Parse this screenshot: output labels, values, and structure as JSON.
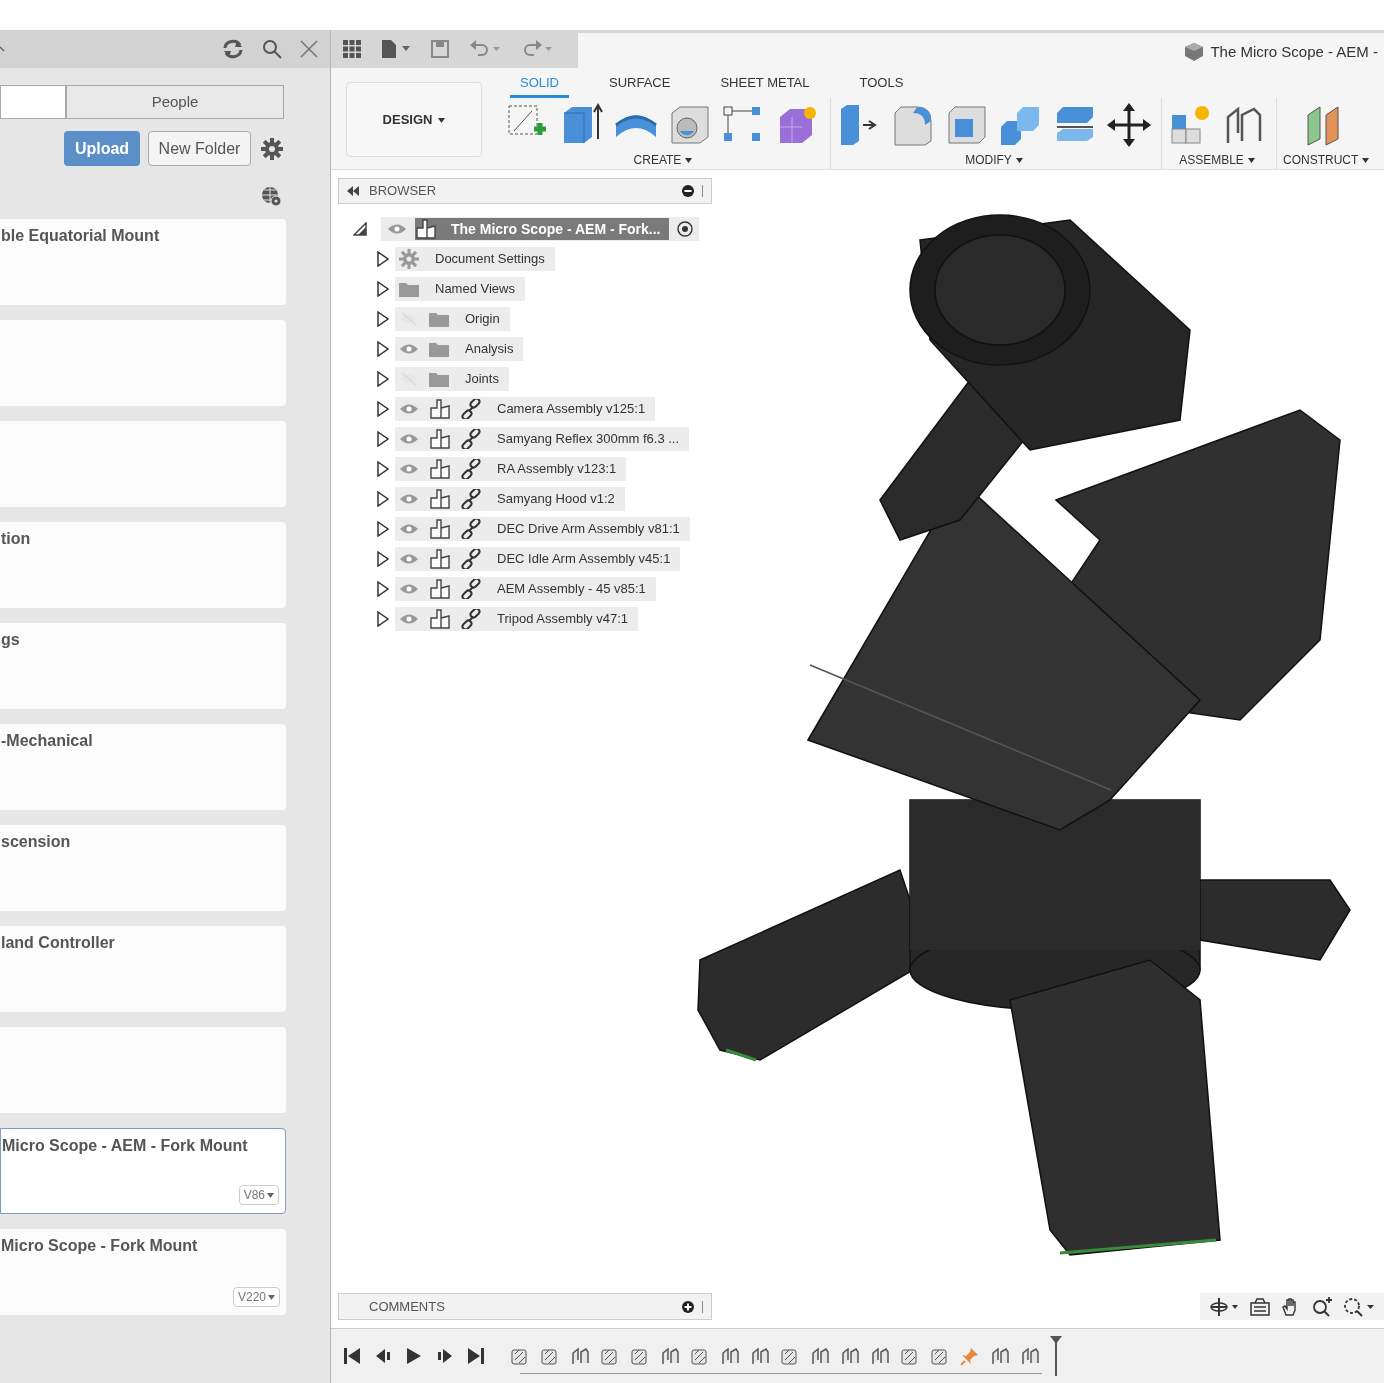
{
  "data_panel": {
    "tabs": [
      {
        "selected": true
      },
      {
        "label": "People",
        "selected": false
      }
    ],
    "buttons": {
      "upload": "Upload",
      "new_folder": "New Folder"
    },
    "cards": [
      {
        "title": "ble Equatorial Mount",
        "selected": false
      },
      {
        "selected": false
      },
      {
        "selected": false
      },
      {
        "title": "tion",
        "selected": false
      },
      {
        "title": "gs",
        "selected": false
      },
      {
        "title": "-Mechanical",
        "selected": false
      },
      {
        "title": "scension",
        "selected": false
      },
      {
        "title": "land Controller",
        "selected": false
      },
      {
        "selected": false
      },
      {
        "title": "Micro Scope - AEM - Fork Mount",
        "version": "V86",
        "selected": true
      },
      {
        "title": "Micro Scope - Fork Mount",
        "version": "V220",
        "selected": false
      }
    ]
  },
  "document_tab": {
    "title": "The Micro Scope - AEM -"
  },
  "toolbar": {
    "workspace": "DESIGN",
    "tabs": [
      {
        "label": "SOLID",
        "selected": true
      },
      {
        "label": "SURFACE",
        "selected": false
      },
      {
        "label": "SHEET METAL",
        "selected": false
      },
      {
        "label": "TOOLS",
        "selected": false
      }
    ],
    "groups": [
      {
        "kind": "create",
        "label": "CREATE"
      },
      {
        "kind": "modify",
        "label": "MODIFY"
      },
      {
        "kind": "assemble",
        "label": "ASSEMBLE"
      },
      {
        "kind": "construct",
        "label": "CONSTRUCT"
      }
    ]
  },
  "browser": {
    "title": "BROWSER",
    "root": {
      "label": "The Micro Scope - AEM - Fork...",
      "expanded": true,
      "selected": true,
      "visible": true,
      "children": [
        {
          "label": "Document Settings",
          "kind": "settings",
          "expanded": false
        },
        {
          "label": "Named Views",
          "kind": "folder",
          "expanded": false
        },
        {
          "label": "Origin",
          "kind": "folder",
          "expanded": false,
          "visible": false
        },
        {
          "label": "Analysis",
          "kind": "folder",
          "expanded": false,
          "visible": true
        },
        {
          "label": "Joints",
          "kind": "folder",
          "expanded": false,
          "visible": false
        },
        {
          "label": "Camera Assembly v125:1",
          "kind": "component",
          "expanded": false,
          "visible": true
        },
        {
          "label": "Samyang Reflex 300mm f6.3 ...",
          "kind": "component",
          "expanded": false,
          "visible": true
        },
        {
          "label": "RA Assembly v123:1",
          "kind": "component",
          "expanded": false,
          "visible": true
        },
        {
          "label": "Samyang Hood v1:2",
          "kind": "component",
          "expanded": false,
          "visible": true
        },
        {
          "label": "DEC Drive Arm Assembly v81:1",
          "kind": "component",
          "expanded": false,
          "visible": true
        },
        {
          "label": "DEC Idle Arm Assembly v45:1",
          "kind": "component",
          "expanded": false,
          "visible": true
        },
        {
          "label": "AEM Assembly - 45 v85:1",
          "kind": "component",
          "expanded": false,
          "visible": true
        },
        {
          "label": "Tripod Assembly v47:1",
          "kind": "component",
          "expanded": false,
          "visible": true
        }
      ]
    }
  },
  "comments": {
    "title": "COMMENTS"
  },
  "timeline": {
    "features": [
      {
        "kind": "component"
      },
      {
        "kind": "component"
      },
      {
        "kind": "joint"
      },
      {
        "kind": "component"
      },
      {
        "kind": "component"
      },
      {
        "kind": "joint"
      },
      {
        "kind": "component"
      },
      {
        "kind": "joint"
      },
      {
        "kind": "joint"
      },
      {
        "kind": "component"
      },
      {
        "kind": "joint"
      },
      {
        "kind": "joint"
      },
      {
        "kind": "joint"
      },
      {
        "kind": "component"
      },
      {
        "kind": "component"
      },
      {
        "kind": "pin"
      },
      {
        "kind": "joint"
      },
      {
        "kind": "joint"
      }
    ]
  }
}
